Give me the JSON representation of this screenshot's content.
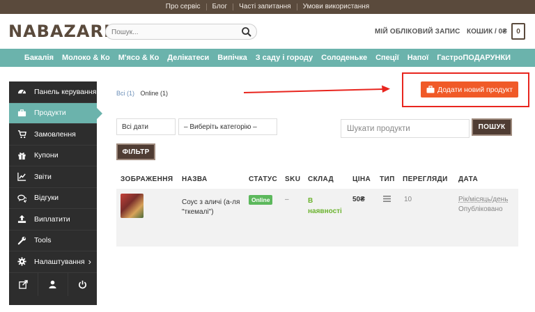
{
  "topbar": {
    "links": [
      "Про сервіс",
      "Блог",
      "Часті запитання",
      "Умови використання"
    ]
  },
  "header": {
    "logo": "NABAZARI",
    "search_placeholder": "Пошук...",
    "account": "МІЙ ОБЛІКОВИЙ ЗАПИС",
    "cart_label": "КОШИК / 0₴",
    "cart_count": "0"
  },
  "categories": [
    "Бакалія",
    "Молоко & Ко",
    "М'ясо & Ко",
    "Делікатеси",
    "Випічка",
    "З саду і городу",
    "Солоденьке",
    "Спеції",
    "Напої",
    "ГастроПОДАРУНКИ"
  ],
  "sidebar": {
    "items": [
      {
        "label": "Панель керування",
        "icon": "dashboard-icon"
      },
      {
        "label": "Продукти",
        "icon": "briefcase-icon",
        "active": true
      },
      {
        "label": "Замовлення",
        "icon": "cart-icon"
      },
      {
        "label": "Купони",
        "icon": "gift-icon"
      },
      {
        "label": "Звіти",
        "icon": "chart-icon"
      },
      {
        "label": "Відгуки",
        "icon": "comments-icon"
      },
      {
        "label": "Виплатити",
        "icon": "upload-icon"
      },
      {
        "label": "Tools",
        "icon": "wrench-icon"
      },
      {
        "label": "Налаштування",
        "icon": "settings-icon"
      }
    ],
    "settings_arrow": "›"
  },
  "main": {
    "filter_all": "Всі (1)",
    "filter_online": "Online (1)",
    "add_product": "Додати новий продукт",
    "date_select": "Всі дати",
    "category_select": "– Виберіть категорію –",
    "search_placeholder": "Шукати продукти",
    "search_button": "ПОШУК",
    "filter_button": "ФІЛЬТР"
  },
  "table": {
    "headers": [
      "ЗОБРАЖЕННЯ",
      "НАЗВА",
      "СТАТУС",
      "SKU",
      "СКЛАД",
      "ЦІНА",
      "ТИП",
      "ПЕРЕГЛЯДИ",
      "ДАТА"
    ],
    "rows": [
      {
        "name_line1": "Соус з аличі (а-ля",
        "name_line2": "\"ткемалі\")",
        "status": "Online",
        "sku": "–",
        "stock_line1": "В",
        "stock_line2": "наявності",
        "price": "50₴",
        "views": "10",
        "date": "Рік/місяць/день",
        "date_status": "Опубліковано"
      }
    ]
  },
  "colors": {
    "topbar": "#5a4a3c",
    "nav": "#6bb3ac",
    "sidebar": "#2d2d2d",
    "accent": "#f05a28",
    "annotation": "#e8251e",
    "online": "#5cb85c"
  }
}
